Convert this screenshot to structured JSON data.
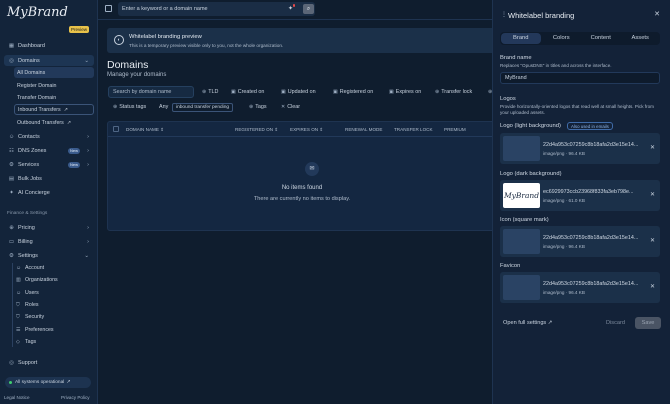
{
  "app": {
    "logo_text": "MyBrand",
    "preview_badge": "Preview"
  },
  "sidebar": {
    "dashboard": "Dashboard",
    "domains": "Domains",
    "domains_sub": [
      "All Domains",
      "Register Domain",
      "Transfer Domain",
      "Inbound Transfers",
      "Outbound Transfers"
    ],
    "contacts": "Contacts",
    "dns_zones": "DNS Zones",
    "dns_new": "New",
    "services": "Services",
    "services_new": "New",
    "bulk_jobs": "Bulk Jobs",
    "ai_concierge": "AI Concierge",
    "finance_label": "Finance & Settings",
    "pricing": "Pricing",
    "billing": "Billing",
    "settings": "Settings",
    "settings_sub": [
      "Account",
      "Organizations",
      "Users",
      "Roles",
      "Security",
      "Preferences",
      "Tags"
    ],
    "support": "Support",
    "status": "All systems operational",
    "legal": "Legal Notice",
    "privacy": "Privacy Policy"
  },
  "search": {
    "placeholder": "Enter a keyword or a domain name"
  },
  "banner": {
    "title": "Whitelabel branding preview",
    "desc": "This is a temporary preview visible only to you, not the whole organization."
  },
  "page": {
    "title": "Domains",
    "subtitle": "Manage your domains"
  },
  "filters": {
    "search_placeholder": "Search by domain name",
    "tld": "TLD",
    "created": "Created on",
    "updated": "Updated on",
    "registered": "Registered on",
    "expires": "Expires on",
    "transfer_lock": "Transfer lock",
    "status_tags": "Status tags",
    "any": "Any",
    "inbound_pending": "inbound transfer pending",
    "tags": "Tags",
    "clear": "Clear"
  },
  "table": {
    "headers": [
      "DOMAIN NAME",
      "REGISTERED ON",
      "EXPIRES ON",
      "RENEWAL MODE",
      "TRANSFER LOCK",
      "PREMIUM"
    ],
    "empty_title": "No items found",
    "empty_desc": "There are currently no items to display."
  },
  "panel": {
    "title": "Whitelabel branding",
    "tabs": [
      "Brand",
      "Colors",
      "Content",
      "Assets"
    ],
    "brand_name_label": "Brand name",
    "brand_name_desc": "Replaces \"OpusDNS\" in titles and across the interface.",
    "brand_name_value": "MyBrand",
    "logos_label": "Logos",
    "logos_desc": "Provide horizontally-oriented logos that read well at small heights. Pick from your uploaded assets.",
    "logo_light_label": "Logo (light background)",
    "used_in_emails": "Also used in emails",
    "logo_dark_label": "Logo (dark background)",
    "icon_label": "Icon (square mark)",
    "favicon_label": "Favicon",
    "files": [
      {
        "name": "22d4a953c07259c8b18afa2d3e15e14...",
        "meta": "image/png · 96.4 KB"
      },
      {
        "name": "ec6929973ccb23968f833fa3eb798e...",
        "meta": "image/png · 61.0 KB"
      },
      {
        "name": "22d4a953c07259c8b18afa2d3e15e14...",
        "meta": "image/png · 96.4 KB"
      },
      {
        "name": "22d4a953c07259c8b18afa2d3e15e14...",
        "meta": "image/png · 96.4 KB"
      }
    ],
    "dark_logo_thumb_text": "MyBrand",
    "open_settings": "Open full settings",
    "discard": "Discard",
    "save": "Save"
  }
}
